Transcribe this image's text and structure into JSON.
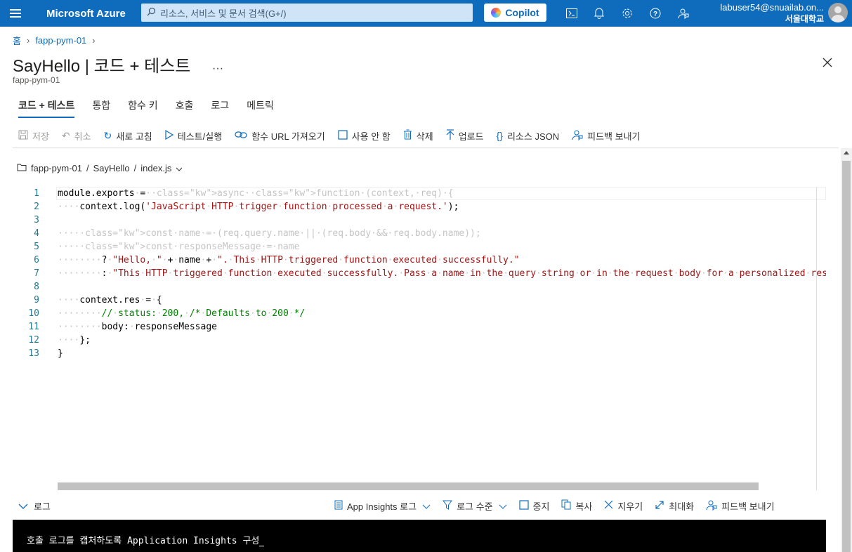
{
  "topbar": {
    "brand": "Microsoft Azure",
    "search_placeholder": "리소스, 서비스 및 문서 검색(G+/)",
    "copilot_label": "Copilot",
    "user_email": "labuser54@snuailab.on...",
    "user_org": "서울대학교",
    "icons": [
      "cloud-shell-icon",
      "bell-icon",
      "gear-icon",
      "help-icon",
      "feedback-icon"
    ]
  },
  "breadcrumb": {
    "home": "홈",
    "resource": "fapp-pym-01"
  },
  "page": {
    "title": "SayHello | 코드 + 테스트",
    "more": "···",
    "subtitle": "fapp-pym-01"
  },
  "tabs": [
    "코드 + 테스트",
    "통합",
    "함수 키",
    "호출",
    "로그",
    "메트릭"
  ],
  "toolbar": {
    "save": "저장",
    "discard": "취소",
    "refresh": "새로 고침",
    "test_run": "테스트/실행",
    "get_url": "함수 URL 가져오기",
    "disable": "사용 안 함",
    "delete": "삭제",
    "upload": "업로드",
    "resource_json": "리소스 JSON",
    "feedback": "피드백 보내기"
  },
  "filepath": {
    "app": "fapp-pym-01",
    "sep": "/",
    "func": "SayHello",
    "file": "index.js"
  },
  "code_lines": [
    "module.exports = async function (context, req) {",
    "    context.log('JavaScript HTTP trigger function processed a request.');",
    "",
    "    const name = (req.query.name || (req.body && req.body.name));",
    "    const responseMessage = name",
    "        ? \"Hello, \" + name + \". This HTTP triggered function executed successfully.\"",
    "        : \"This HTTP triggered function executed successfully. Pass a name in the query string or in the request body for a personalized respo",
    "",
    "    context.res = {",
    "        // status: 200, /* Defaults to 200 */",
    "        body: responseMessage",
    "    };",
    "}"
  ],
  "logbar": {
    "log_label": "로그",
    "app_insights": "App Insights 로그",
    "log_level": "로그 수준",
    "stop": "중지",
    "copy": "복사",
    "clear": "지우기",
    "maximize": "최대화",
    "feedback": "피드백 보내기"
  },
  "console_text": "호출 로그를 캡처하도록 Application Insights 구성"
}
